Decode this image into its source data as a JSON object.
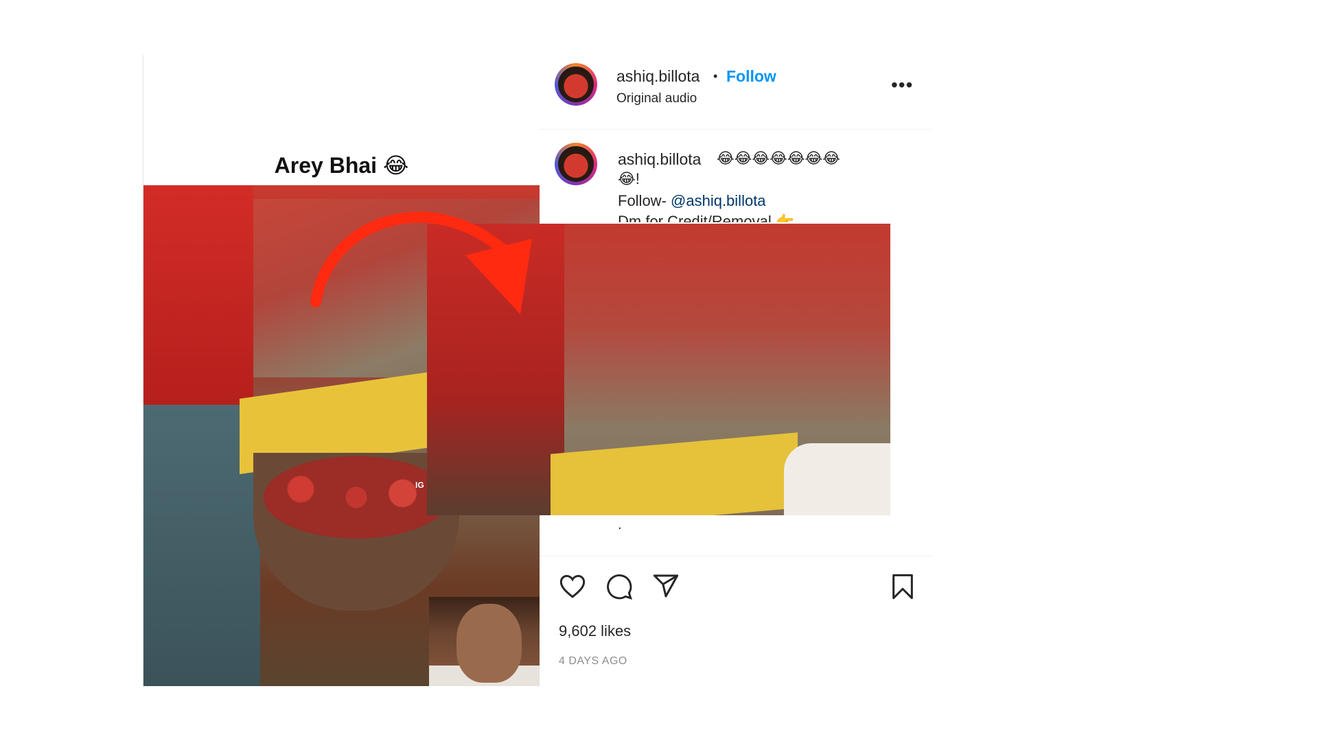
{
  "post": {
    "video_caption": "Arey Bhai 😂",
    "watermark": "IG"
  },
  "header": {
    "username": "ashiq.billota",
    "separator": "•",
    "follow_label": "Follow",
    "audio": "Original audio",
    "more_label": "•••"
  },
  "caption": {
    "username": "ashiq.billota",
    "emojis_line1": "😂😂😂😂😂😂😂",
    "emojis_line2": "😂!",
    "follow_prefix": "Follow- ",
    "mention": "@ashiq.billota",
    "credit": "Dm for Credit/Removal 👉",
    "dot1": ".",
    "dot2": "."
  },
  "actions": {
    "likes": "9,602 likes",
    "time_ago": "4 DAYS AGO"
  },
  "icons": {
    "like": "heart-icon",
    "comment": "comment-icon",
    "share": "share-icon",
    "save": "bookmark-icon",
    "annotation": "curved-arrow-icon"
  },
  "colors": {
    "follow": "#0095f6",
    "arrow": "#ff2a10",
    "text": "#262626",
    "muted": "#8e8e8e"
  }
}
